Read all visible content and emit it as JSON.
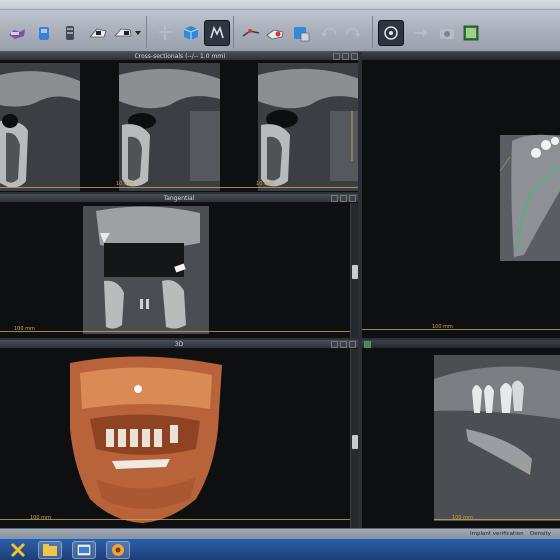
{
  "panes": {
    "cross_sectionals": {
      "title": "Cross-sectionals (--/-- 1.0 mm)",
      "scale": "10 mm"
    },
    "tangential": {
      "title": "Tangential",
      "scale": "100 mm"
    },
    "axial": {
      "title": "",
      "scale": "100 mm"
    },
    "volume_3d": {
      "title": "3D",
      "scale": "100 mm"
    },
    "panoramic": {
      "title": "",
      "scale": "100 mm"
    }
  },
  "status": {
    "implant_verification": "Implant verification",
    "density": "Density"
  },
  "toolbar": {
    "icons": [
      "mandible-icon",
      "tooth-icon",
      "implant-icon",
      "nerve-icon",
      "crown-icon",
      "dropdown-icon",
      "pointer-icon",
      "cube-icon",
      "bone-icon",
      "measure-icon",
      "annotate-icon",
      "tooth-view-icon",
      "undo-icon",
      "redo-icon",
      "screenshot-icon",
      "arrow-icon",
      "camera-icon",
      "report-icon"
    ]
  },
  "taskbar": {
    "icons": [
      "start-icon",
      "windows-explorer-icon",
      "app-icon",
      "settings-icon"
    ]
  },
  "colors": {
    "bone": "#bfc1c3",
    "volume": "#c06a3c",
    "nerve_line": "#3bbf6a",
    "ruler": "#c7a54a"
  }
}
